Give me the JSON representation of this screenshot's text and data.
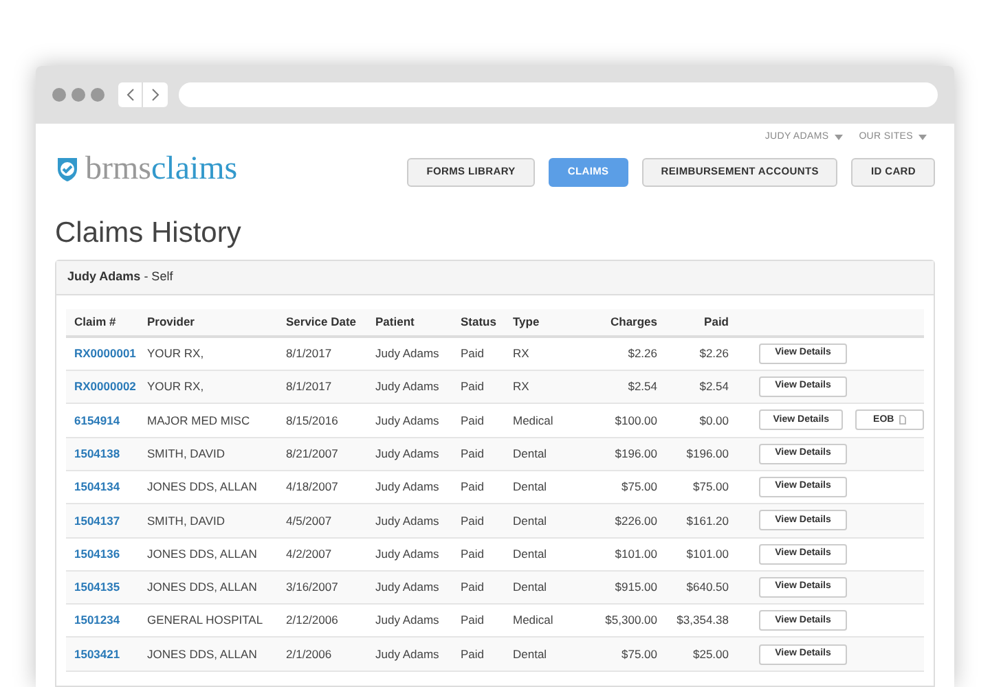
{
  "user_links": [
    {
      "label": "JUDY ADAMS"
    },
    {
      "label": "OUR SITES"
    }
  ],
  "logo": {
    "part_1": "brms",
    "part_2": "claims"
  },
  "nav": [
    {
      "label": "FORMS LIBRARY",
      "selected": false
    },
    {
      "label": "CLAIMS",
      "selected": true
    },
    {
      "label": "REIMBURSEMENT ACCOUNTS",
      "selected": false
    },
    {
      "label": "ID CARD",
      "selected": false
    }
  ],
  "title": "Claims History",
  "panel": {
    "heading": "**Judy Adams** - Self"
  },
  "table": {
    "columns": [
      "Claim #",
      "Provider",
      "Service Date",
      "Patient",
      "Status",
      "Type",
      "Charges",
      "Paid"
    ],
    "rows": [
      {
        "claim": "RX0000001",
        "provider": "YOUR RX,",
        "date": "8/1/2017",
        "patient": "Judy Adams",
        "status": "Paid",
        "type": "RX",
        "charges": "$2.26",
        "paid": "$2.26",
        "action": "View Details"
      },
      {
        "claim": "RX0000002",
        "provider": "YOUR RX,",
        "date": "8/1/2017",
        "patient": "Judy Adams",
        "status": "Paid",
        "type": "RX",
        "charges": "$2.54",
        "paid": "$2.54",
        "action": "View Details"
      },
      {
        "claim": "6154914",
        "provider": "MAJOR MED MISC",
        "date": "8/15/2016",
        "patient": "Judy Adams",
        "status": "Paid",
        "type": "Medical",
        "charges": "$100.00",
        "paid": "$0.00",
        "action": "View Details",
        "eob": "EOB"
      },
      {
        "claim": "1504138",
        "provider": "SMITH, DAVID",
        "date": "8/21/2007",
        "patient": "Judy Adams",
        "status": "Paid",
        "type": "Dental",
        "charges": "$196.00",
        "paid": "$196.00",
        "action": "View Details"
      },
      {
        "claim": "1504134",
        "provider": "JONES DDS, ALLAN",
        "date": "4/18/2007",
        "patient": "Judy Adams",
        "status": "Paid",
        "type": "Dental",
        "charges": "$75.00",
        "paid": "$75.00",
        "action": "View Details"
      },
      {
        "claim": "1504137",
        "provider": "SMITH, DAVID",
        "date": "4/5/2007",
        "patient": "Judy Adams",
        "status": "Paid",
        "type": "Dental",
        "charges": "$226.00",
        "paid": "$161.20",
        "action": "View Details"
      },
      {
        "claim": "1504136",
        "provider": "JONES DDS, ALLAN",
        "date": "4/2/2007",
        "patient": "Judy Adams",
        "status": "Paid",
        "type": "Dental",
        "charges": "$101.00",
        "paid": "$101.00",
        "action": "View Details"
      },
      {
        "claim": "1504135",
        "provider": "JONES DDS, ALLAN",
        "date": "3/16/2007",
        "patient": "Judy Adams",
        "status": "Paid",
        "type": "Dental",
        "charges": "$915.00",
        "paid": "$640.50",
        "action": "View Details"
      },
      {
        "claim": "1501234",
        "provider": "GENERAL HOSPITAL",
        "date": "2/12/2006",
        "patient": "Judy Adams",
        "status": "Paid",
        "type": "Medical",
        "charges": "$5,300.00",
        "paid": "$3,354.38",
        "action": "View Details"
      },
      {
        "claim": "1503421",
        "provider": "JONES DDS, ALLAN",
        "date": "2/1/2006",
        "patient": "Judy Adams",
        "status": "Paid",
        "type": "Dental",
        "charges": "$75.00",
        "paid": "$25.00",
        "action": "View Details"
      }
    ]
  }
}
